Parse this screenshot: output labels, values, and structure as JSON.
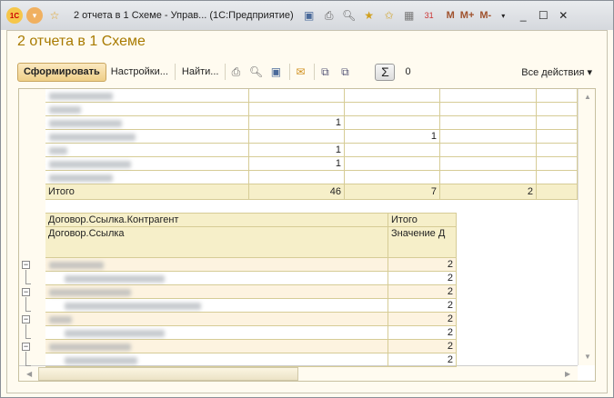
{
  "window": {
    "title": "2 отчета в 1 Схеме - Управ...  (1С:Предприятие)",
    "memory_buttons": [
      "M",
      "M+",
      "M-"
    ]
  },
  "page": {
    "title": "2 отчета в 1 Схеме"
  },
  "toolbar": {
    "generate": "Сформировать",
    "settings": "Настройки...",
    "find": "Найти...",
    "sum_value": "0",
    "all_actions": "Все действия ▾"
  },
  "top_table": {
    "rows": [
      [
        "",
        "",
        ""
      ],
      [
        "",
        "",
        ""
      ],
      [
        "1",
        "",
        ""
      ],
      [
        "",
        "1",
        ""
      ],
      [
        "1",
        "",
        ""
      ],
      [
        "1",
        "",
        ""
      ],
      [
        "",
        "",
        ""
      ]
    ],
    "total": {
      "label": "Итого",
      "values": [
        "46",
        "7",
        "2"
      ]
    }
  },
  "bottom_table": {
    "header1": [
      "Договор.Ссылка.Контрагент",
      "Итого"
    ],
    "header2": [
      "Договор.Ссылка",
      "Значение Д"
    ],
    "values": [
      "2",
      "2",
      "2",
      "2",
      "2",
      "2",
      "2",
      "2"
    ]
  }
}
